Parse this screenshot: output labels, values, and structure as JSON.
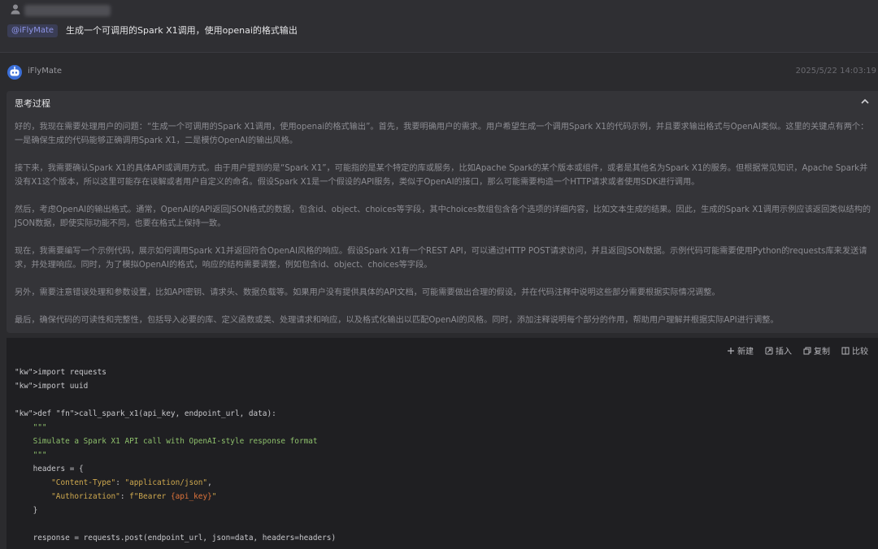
{
  "user": {
    "mention": "@iFlyMate",
    "message": "生成一个可调用的Spark X1调用，使用openai的格式输出"
  },
  "bot": {
    "name": "iFlyMate",
    "timestamp": "2025/5/22 14:03:19"
  },
  "thinking": {
    "title": "思考过程",
    "paragraphs": [
      "好的，我现在需要处理用户的问题：“生成一个可调用的Spark X1调用，使用openai的格式输出”。首先，我要明确用户的需求。用户希望生成一个调用Spark X1的代码示例，并且要求输出格式与OpenAI类似。这里的关键点有两个：一是确保生成的代码能够正确调用Spark X1，二是模仿OpenAI的输出风格。",
      "接下来，我需要确认Spark X1的具体API或调用方式。由于用户提到的是“Spark X1”，可能指的是某个特定的库或服务，比如Apache Spark的某个版本或组件，或者是其他名为Spark X1的服务。但根据常见知识，Apache Spark并没有X1这个版本，所以这里可能存在误解或者用户自定义的命名。假设Spark X1是一个假设的API服务，类似于OpenAI的接口，那么可能需要构造一个HTTP请求或者使用SDK进行调用。",
      "然后，考虑OpenAI的输出格式。通常，OpenAI的API返回JSON格式的数据，包含id、object、choices等字段，其中choices数组包含各个选项的详细内容，比如文本生成的结果。因此，生成的Spark X1调用示例应该返回类似结构的JSON数据，即使实际功能不同，也要在格式上保持一致。",
      "现在，我需要编写一个示例代码，展示如何调用Spark X1并返回符合OpenAI风格的响应。假设Spark X1有一个REST API，可以通过HTTP POST请求访问，并且返回JSON数据。示例代码可能需要使用Python的requests库来发送请求，并处理响应。同时，为了模拟OpenAI的格式，响应的结构需要调整，例如包含id、object、choices等字段。",
      "另外，需要注意错误处理和参数设置，比如API密钥、请求头、数据负载等。如果用户没有提供具体的API文档，可能需要做出合理的假设，并在代码注释中说明这些部分需要根据实际情况调整。",
      "最后，确保代码的可读性和完整性，包括导入必要的库、定义函数或类、处理请求和响应，以及格式化输出以匹配OpenAI的风格。同时，添加注释说明每个部分的作用，帮助用户理解并根据实际API进行调整。"
    ]
  },
  "toolbar": {
    "new_label": "新建",
    "insert_label": "插入",
    "copy_label": "复制",
    "compare_label": "比较"
  },
  "code": {
    "lines": [
      "import requests",
      "import uuid",
      "",
      "def call_spark_x1(api_key, endpoint_url, data):",
      "    \"\"\"",
      "    Simulate a Spark X1 API call with OpenAI-style response format",
      "    \"\"\"",
      "    headers = {",
      "        \"Content-Type\": \"application/json\",",
      "        \"Authorization\": f\"Bearer {api_key}\"",
      "    }",
      "",
      "    response = requests.post(endpoint_url, json=data, headers=headers)"
    ]
  }
}
